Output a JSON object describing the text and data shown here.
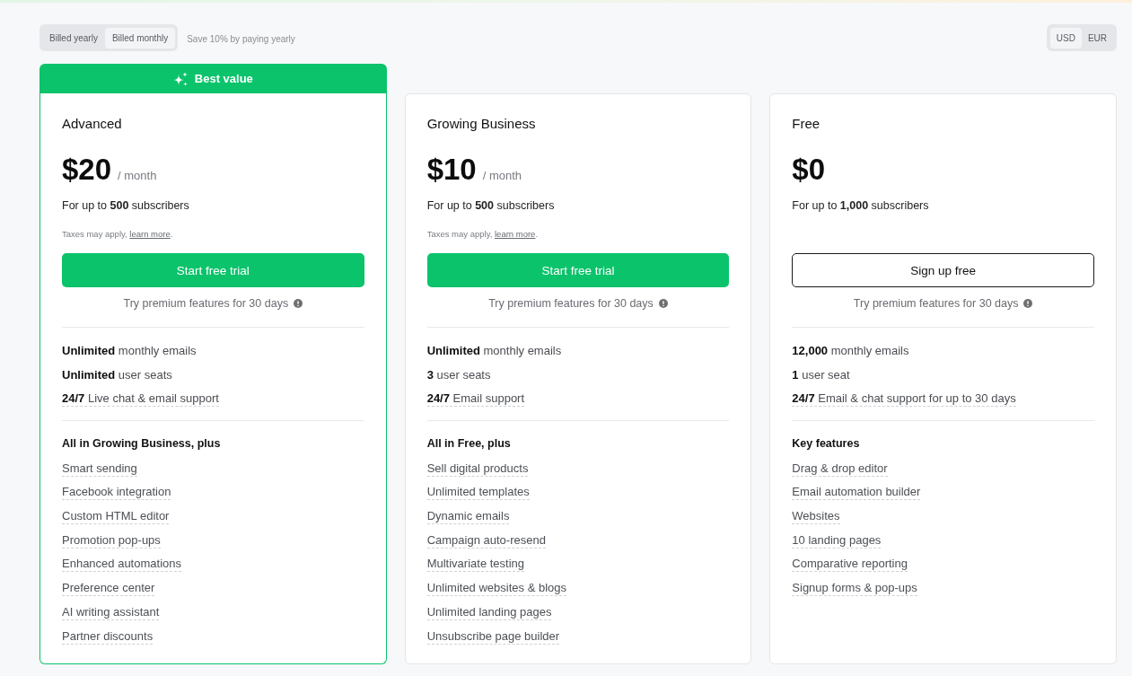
{
  "billing": {
    "options": [
      {
        "label": "Billed yearly",
        "selected": false
      },
      {
        "label": "Billed monthly",
        "selected": true
      }
    ],
    "note": "Save 10% by paying yearly"
  },
  "currency": {
    "options": [
      {
        "label": "USD",
        "selected": true
      },
      {
        "label": "EUR",
        "selected": false
      }
    ]
  },
  "plans": [
    {
      "badge": "Best value",
      "highlighted": true,
      "name": "Advanced",
      "price": "$20",
      "period": "/ month",
      "subscribers": "For up to **500** subscribers",
      "taxes": {
        "text": "Taxes may apply,",
        "link": "learn more",
        "end": "."
      },
      "button": {
        "label": "Start free trial",
        "kind": "primary"
      },
      "trial_note": "Try premium features for 30 days",
      "limits": [
        {
          "text": "**Unlimited** monthly emails",
          "underlined": false
        },
        {
          "text": "**Unlimited** user seats",
          "underlined": false
        },
        {
          "text": "**24/7** Live chat & email support",
          "underlined": true
        }
      ],
      "features_heading": "All in Growing Business, plus",
      "features": [
        "Smart sending",
        "Facebook integration",
        "Custom HTML editor",
        "Promotion pop-ups",
        "Enhanced automations",
        "Preference center",
        "AI writing assistant",
        "Partner discounts"
      ]
    },
    {
      "highlighted": false,
      "name": "Growing Business",
      "price": "$10",
      "period": "/ month",
      "subscribers": "For up to **500** subscribers",
      "taxes": {
        "text": "Taxes may apply,",
        "link": "learn more",
        "end": "."
      },
      "button": {
        "label": "Start free trial",
        "kind": "primary"
      },
      "trial_note": "Try premium features for 30 days",
      "limits": [
        {
          "text": "**Unlimited** monthly emails",
          "underlined": false
        },
        {
          "text": "**3** user seats",
          "underlined": false
        },
        {
          "text": "**24/7** Email support",
          "underlined": true
        }
      ],
      "features_heading": "All in Free, plus",
      "features": [
        "Sell digital products",
        "Unlimited templates",
        "Dynamic emails",
        "Campaign auto-resend",
        "Multivariate testing",
        "Unlimited websites & blogs",
        "Unlimited landing pages",
        "Unsubscribe page builder"
      ]
    },
    {
      "highlighted": false,
      "name": "Free",
      "price": "$0",
      "subscribers": "For up to **1,000** subscribers",
      "button": {
        "label": "Sign up free",
        "kind": "outline"
      },
      "trial_note": "Try premium features for 30 days",
      "limits": [
        {
          "text": "**12,000** monthly emails",
          "underlined": false
        },
        {
          "text": "**1** user seat",
          "underlined": false
        },
        {
          "text": "**24/7** Email & chat support for up to 30 days",
          "underlined": true
        }
      ],
      "features_heading": "Key features",
      "features": [
        "Drag & drop editor",
        "Email automation builder",
        "Websites",
        "10 landing pages",
        "Comparative reporting",
        "Signup forms & pop-ups"
      ]
    }
  ]
}
